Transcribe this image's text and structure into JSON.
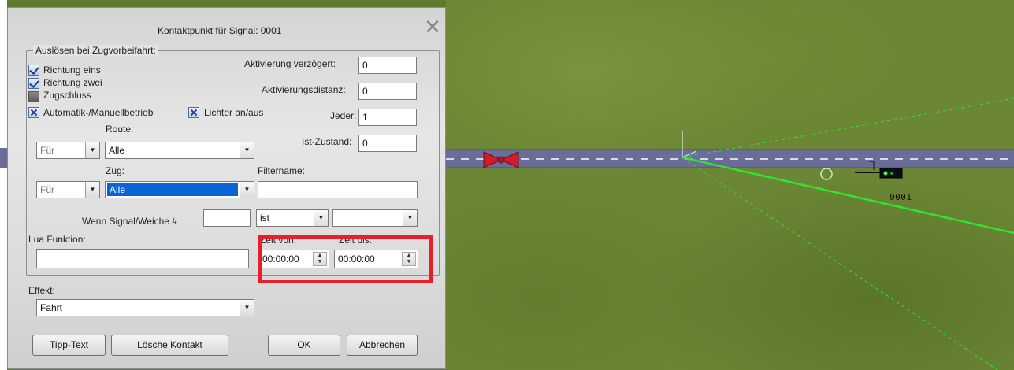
{
  "dialog": {
    "title": "Kontaktpunkt für Signal: 0001",
    "close_glyph": "✕"
  },
  "trigger_group": {
    "label": "Auslösen bei Zugvorbeifahrt:",
    "checkboxes": [
      {
        "label": "Richtung eins",
        "checked": true
      },
      {
        "label": "Richtung zwei",
        "checked": true
      },
      {
        "label": "Zugschluss",
        "checked": false
      },
      {
        "label": "Automatik-/Manuellbetrieb",
        "checked": true
      },
      {
        "label": "Lichter an/aus",
        "checked": true
      }
    ]
  },
  "fields": {
    "aktivierung_verzoegert": {
      "label": "Aktivierung verzögert:",
      "value": "0"
    },
    "aktivierungsdistanz": {
      "label": "Aktivierungsdistanz:",
      "value": "0"
    },
    "jeder": {
      "label": "Jeder:",
      "value": "1"
    },
    "ist_zustand": {
      "label": "Ist-Zustand:",
      "value": "0"
    }
  },
  "route": {
    "label": "Route:",
    "prefix_value": "Für",
    "value": "Alle"
  },
  "zug": {
    "label": "Zug:",
    "prefix_value": "Für",
    "value": "Alle"
  },
  "filtername": {
    "label": "Filtername:",
    "value": ""
  },
  "wenn": {
    "label": "Wenn Signal/Weiche #",
    "number": "",
    "condition": "ist",
    "state": ""
  },
  "lua": {
    "label": "Lua Funktion:",
    "value": ""
  },
  "zeit": {
    "von_label": "Zeit von:",
    "von_value": "00:00:00",
    "bis_label": "Zeit bis:",
    "bis_value": "00:00:00",
    "spin_up": "▲",
    "spin_down": "▼"
  },
  "effekt": {
    "label": "Effekt:",
    "value": "Fahrt"
  },
  "buttons": {
    "tipp_text": "Tipp-Text",
    "loesche_kontakt": "Lösche Kontakt",
    "ok": "OK",
    "abbrechen": "Abbrechen"
  },
  "combo_arrow": "▼",
  "map": {
    "signal_label": "0001"
  },
  "colors": {
    "highlight": "#e5202c",
    "selection": "#0a64d6",
    "road": "#6a6d98",
    "contact_line": "#2ee62e"
  }
}
